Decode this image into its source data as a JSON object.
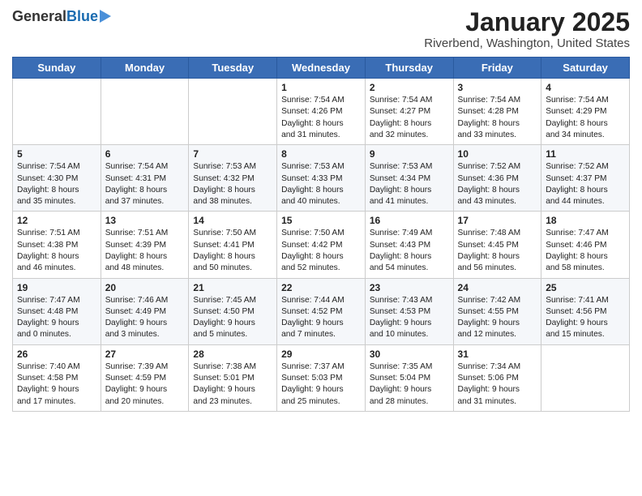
{
  "header": {
    "logo_general": "General",
    "logo_blue": "Blue",
    "month_title": "January 2025",
    "location": "Riverbend, Washington, United States"
  },
  "weekdays": [
    "Sunday",
    "Monday",
    "Tuesday",
    "Wednesday",
    "Thursday",
    "Friday",
    "Saturday"
  ],
  "weeks": [
    [
      {
        "day": "",
        "info": ""
      },
      {
        "day": "",
        "info": ""
      },
      {
        "day": "",
        "info": ""
      },
      {
        "day": "1",
        "info": "Sunrise: 7:54 AM\nSunset: 4:26 PM\nDaylight: 8 hours\nand 31 minutes."
      },
      {
        "day": "2",
        "info": "Sunrise: 7:54 AM\nSunset: 4:27 PM\nDaylight: 8 hours\nand 32 minutes."
      },
      {
        "day": "3",
        "info": "Sunrise: 7:54 AM\nSunset: 4:28 PM\nDaylight: 8 hours\nand 33 minutes."
      },
      {
        "day": "4",
        "info": "Sunrise: 7:54 AM\nSunset: 4:29 PM\nDaylight: 8 hours\nand 34 minutes."
      }
    ],
    [
      {
        "day": "5",
        "info": "Sunrise: 7:54 AM\nSunset: 4:30 PM\nDaylight: 8 hours\nand 35 minutes."
      },
      {
        "day": "6",
        "info": "Sunrise: 7:54 AM\nSunset: 4:31 PM\nDaylight: 8 hours\nand 37 minutes."
      },
      {
        "day": "7",
        "info": "Sunrise: 7:53 AM\nSunset: 4:32 PM\nDaylight: 8 hours\nand 38 minutes."
      },
      {
        "day": "8",
        "info": "Sunrise: 7:53 AM\nSunset: 4:33 PM\nDaylight: 8 hours\nand 40 minutes."
      },
      {
        "day": "9",
        "info": "Sunrise: 7:53 AM\nSunset: 4:34 PM\nDaylight: 8 hours\nand 41 minutes."
      },
      {
        "day": "10",
        "info": "Sunrise: 7:52 AM\nSunset: 4:36 PM\nDaylight: 8 hours\nand 43 minutes."
      },
      {
        "day": "11",
        "info": "Sunrise: 7:52 AM\nSunset: 4:37 PM\nDaylight: 8 hours\nand 44 minutes."
      }
    ],
    [
      {
        "day": "12",
        "info": "Sunrise: 7:51 AM\nSunset: 4:38 PM\nDaylight: 8 hours\nand 46 minutes."
      },
      {
        "day": "13",
        "info": "Sunrise: 7:51 AM\nSunset: 4:39 PM\nDaylight: 8 hours\nand 48 minutes."
      },
      {
        "day": "14",
        "info": "Sunrise: 7:50 AM\nSunset: 4:41 PM\nDaylight: 8 hours\nand 50 minutes."
      },
      {
        "day": "15",
        "info": "Sunrise: 7:50 AM\nSunset: 4:42 PM\nDaylight: 8 hours\nand 52 minutes."
      },
      {
        "day": "16",
        "info": "Sunrise: 7:49 AM\nSunset: 4:43 PM\nDaylight: 8 hours\nand 54 minutes."
      },
      {
        "day": "17",
        "info": "Sunrise: 7:48 AM\nSunset: 4:45 PM\nDaylight: 8 hours\nand 56 minutes."
      },
      {
        "day": "18",
        "info": "Sunrise: 7:47 AM\nSunset: 4:46 PM\nDaylight: 8 hours\nand 58 minutes."
      }
    ],
    [
      {
        "day": "19",
        "info": "Sunrise: 7:47 AM\nSunset: 4:48 PM\nDaylight: 9 hours\nand 0 minutes."
      },
      {
        "day": "20",
        "info": "Sunrise: 7:46 AM\nSunset: 4:49 PM\nDaylight: 9 hours\nand 3 minutes."
      },
      {
        "day": "21",
        "info": "Sunrise: 7:45 AM\nSunset: 4:50 PM\nDaylight: 9 hours\nand 5 minutes."
      },
      {
        "day": "22",
        "info": "Sunrise: 7:44 AM\nSunset: 4:52 PM\nDaylight: 9 hours\nand 7 minutes."
      },
      {
        "day": "23",
        "info": "Sunrise: 7:43 AM\nSunset: 4:53 PM\nDaylight: 9 hours\nand 10 minutes."
      },
      {
        "day": "24",
        "info": "Sunrise: 7:42 AM\nSunset: 4:55 PM\nDaylight: 9 hours\nand 12 minutes."
      },
      {
        "day": "25",
        "info": "Sunrise: 7:41 AM\nSunset: 4:56 PM\nDaylight: 9 hours\nand 15 minutes."
      }
    ],
    [
      {
        "day": "26",
        "info": "Sunrise: 7:40 AM\nSunset: 4:58 PM\nDaylight: 9 hours\nand 17 minutes."
      },
      {
        "day": "27",
        "info": "Sunrise: 7:39 AM\nSunset: 4:59 PM\nDaylight: 9 hours\nand 20 minutes."
      },
      {
        "day": "28",
        "info": "Sunrise: 7:38 AM\nSunset: 5:01 PM\nDaylight: 9 hours\nand 23 minutes."
      },
      {
        "day": "29",
        "info": "Sunrise: 7:37 AM\nSunset: 5:03 PM\nDaylight: 9 hours\nand 25 minutes."
      },
      {
        "day": "30",
        "info": "Sunrise: 7:35 AM\nSunset: 5:04 PM\nDaylight: 9 hours\nand 28 minutes."
      },
      {
        "day": "31",
        "info": "Sunrise: 7:34 AM\nSunset: 5:06 PM\nDaylight: 9 hours\nand 31 minutes."
      },
      {
        "day": "",
        "info": ""
      }
    ]
  ]
}
